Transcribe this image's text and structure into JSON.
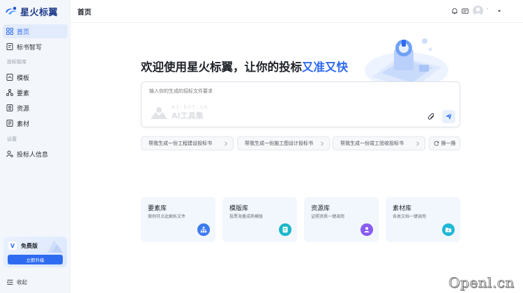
{
  "app": {
    "name": "星火标翼"
  },
  "header": {
    "title": "首页",
    "username": "·"
  },
  "sidebar": {
    "items_top": [
      {
        "label": "首页",
        "icon": "grid-icon",
        "active": true
      },
      {
        "label": "标书智写",
        "icon": "document-edit-icon",
        "active": false
      }
    ],
    "section_library": "投标智库",
    "items_library": [
      {
        "label": "模板",
        "icon": "template-icon"
      },
      {
        "label": "要素",
        "icon": "elements-icon"
      },
      {
        "label": "资源",
        "icon": "resource-icon"
      },
      {
        "label": "素材",
        "icon": "material-icon"
      }
    ],
    "section_settings": "设置",
    "items_settings": [
      {
        "label": "投标人信息",
        "icon": "user-settings-icon"
      }
    ],
    "upgrade": {
      "badge": "V",
      "plan": "免费版",
      "button": "立即升级"
    },
    "collapse_label": "收起"
  },
  "main": {
    "headline_prefix": "欢迎使用星火标翼，让你的投标",
    "headline_accent": "又准又快",
    "composer": {
      "placeholder": "输入你的生成的招标文件要求",
      "watermark_top": "ai-bot.cn",
      "watermark_bottom": "AI工具集"
    },
    "suggestions": [
      "帮我生成一份工程建设投标书",
      "帮我生成一份施工图设计投标书",
      "帮我生成一份竣工验收投标书"
    ],
    "refresh_label": "换一换",
    "libraries": [
      {
        "title": "要素库",
        "desc": "案例可点此解析文件",
        "color": "#3d7bf2",
        "icon": "hierarchy-icon"
      },
      {
        "title": "模版库",
        "desc": "投票海量成熟模版",
        "color": "#19b7c9",
        "icon": "template-doc-icon"
      },
      {
        "title": "资源库",
        "desc": "证照资质一键调用",
        "color": "#8a5cf0",
        "icon": "person-badge-icon"
      },
      {
        "title": "素材库",
        "desc": "各类文档一键调用",
        "color": "#1fb8d6",
        "icon": "folder-icon"
      }
    ]
  },
  "watermark_site": "Openl.cn",
  "colors": {
    "accent": "#2f6bf0",
    "sidebar_bg": "#f3f6fb",
    "card_bg": "#f2f6fd"
  }
}
